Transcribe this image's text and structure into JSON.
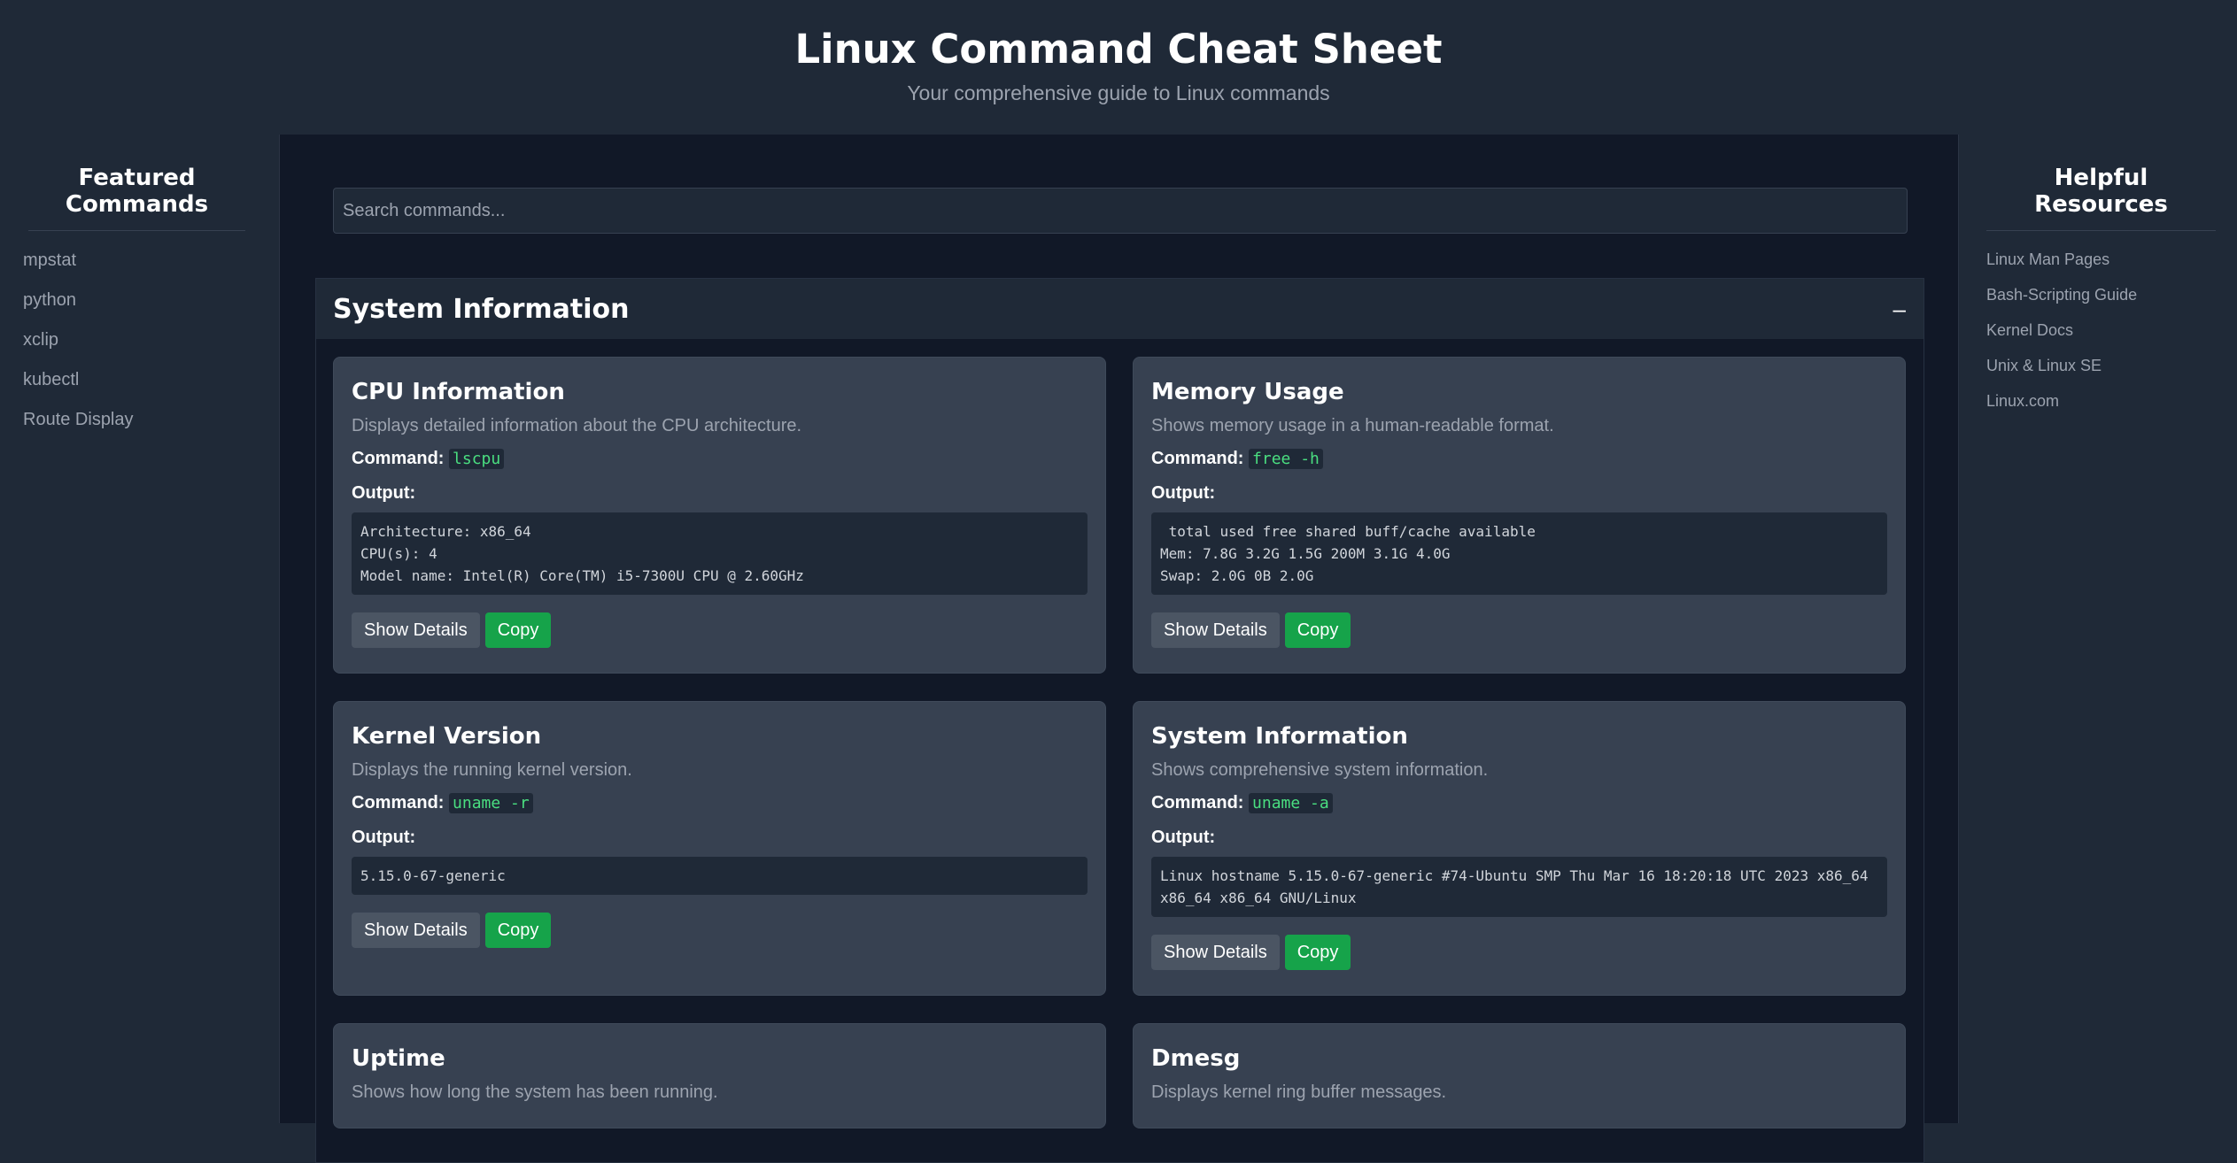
{
  "header": {
    "title": "Linux Command Cheat Sheet",
    "subtitle": "Your comprehensive guide to Linux commands"
  },
  "left_sidebar": {
    "heading": "Featured Commands",
    "items": [
      "mpstat",
      "python",
      "xclip",
      "kubectl",
      "Route Display"
    ]
  },
  "right_sidebar": {
    "heading": "Helpful Resources",
    "items": [
      "Linux Man Pages",
      "Bash-Scripting Guide",
      "Kernel Docs",
      "Unix & Linux SE",
      "Linux.com"
    ]
  },
  "search": {
    "placeholder": "Search commands..."
  },
  "section": {
    "title": "System Information",
    "toggle": "–"
  },
  "labels": {
    "command": "Command:",
    "output": "Output:",
    "show_details": "Show Details",
    "copy": "Copy"
  },
  "cards": [
    {
      "title": "CPU Information",
      "description": "Displays detailed information about the CPU architecture.",
      "command": "lscpu",
      "output": "Architecture: x86_64\nCPU(s): 4\nModel name: Intel(R) Core(TM) i5-7300U CPU @ 2.60GHz"
    },
    {
      "title": "Memory Usage",
      "description": "Shows memory usage in a human-readable format.",
      "command": "free -h",
      "output": " total used free shared buff/cache available\nMem: 7.8G 3.2G 1.5G 200M 3.1G 4.0G\nSwap: 2.0G 0B 2.0G"
    },
    {
      "title": "Kernel Version",
      "description": "Displays the running kernel version.",
      "command": "uname -r",
      "output": "5.15.0-67-generic"
    },
    {
      "title": "System Information",
      "description": "Shows comprehensive system information.",
      "command": "uname -a",
      "output": "Linux hostname 5.15.0-67-generic #74-Ubuntu SMP Thu Mar 16 18:20:18 UTC 2023 x86_64 x86_64 x86_64 GNU/Linux"
    },
    {
      "title": "Uptime",
      "description": "Shows how long the system has been running."
    },
    {
      "title": "Dmesg",
      "description": "Displays kernel ring buffer messages."
    }
  ]
}
